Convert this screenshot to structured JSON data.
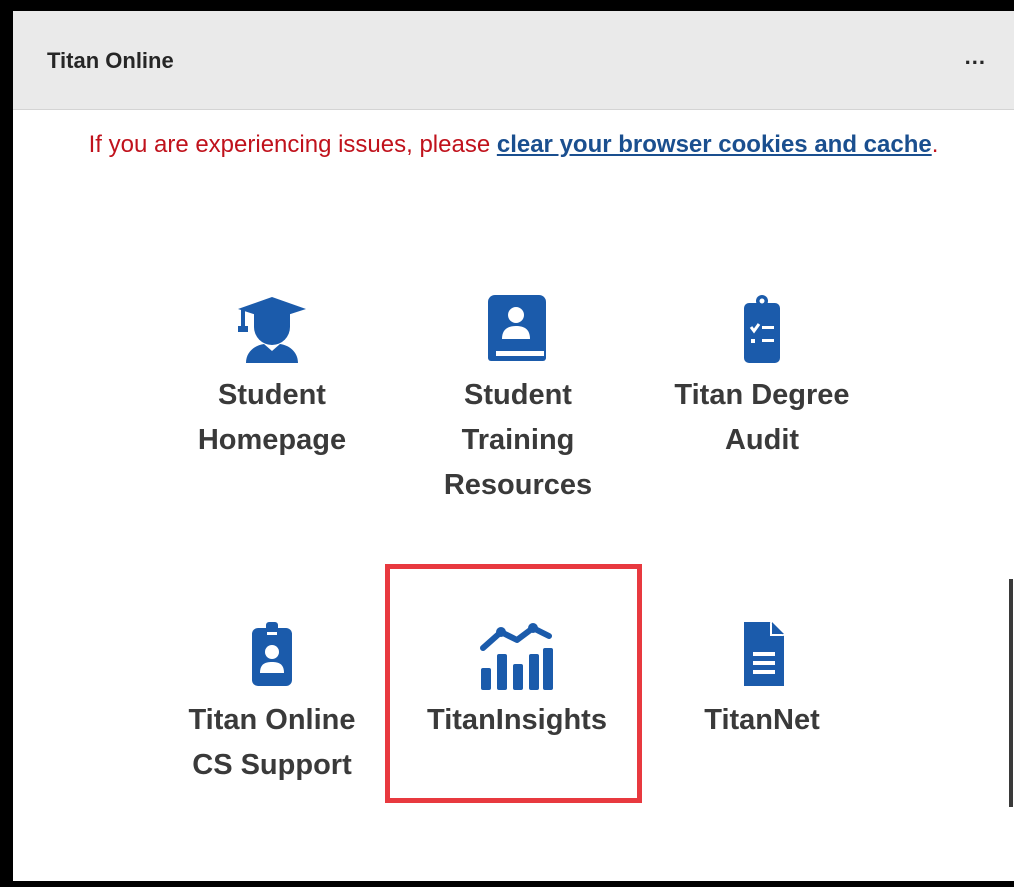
{
  "header": {
    "title": "Titan Online",
    "menu_label": "..."
  },
  "notice": {
    "prefix": "If you are experiencing issues, please ",
    "link_text": "clear your browser cookies and cache",
    "suffix": "."
  },
  "tiles": [
    {
      "label": "Student Homepage",
      "icon": "graduate-icon"
    },
    {
      "label": "Student Training Resources",
      "icon": "contact-book-icon"
    },
    {
      "label": "Titan Degree Audit",
      "icon": "clipboard-checklist-icon"
    },
    {
      "label": "Titan Online CS Support",
      "icon": "id-badge-icon"
    },
    {
      "label": "TitanInsights",
      "icon": "chart-icon",
      "highlighted": true
    },
    {
      "label": "TitanNet",
      "icon": "document-icon"
    }
  ],
  "colors": {
    "icon": "#1b5bab",
    "notice_text": "#c0121c",
    "link": "#1a4f8f",
    "highlight_border": "#e8393f",
    "header_bg": "#eaeaea"
  }
}
